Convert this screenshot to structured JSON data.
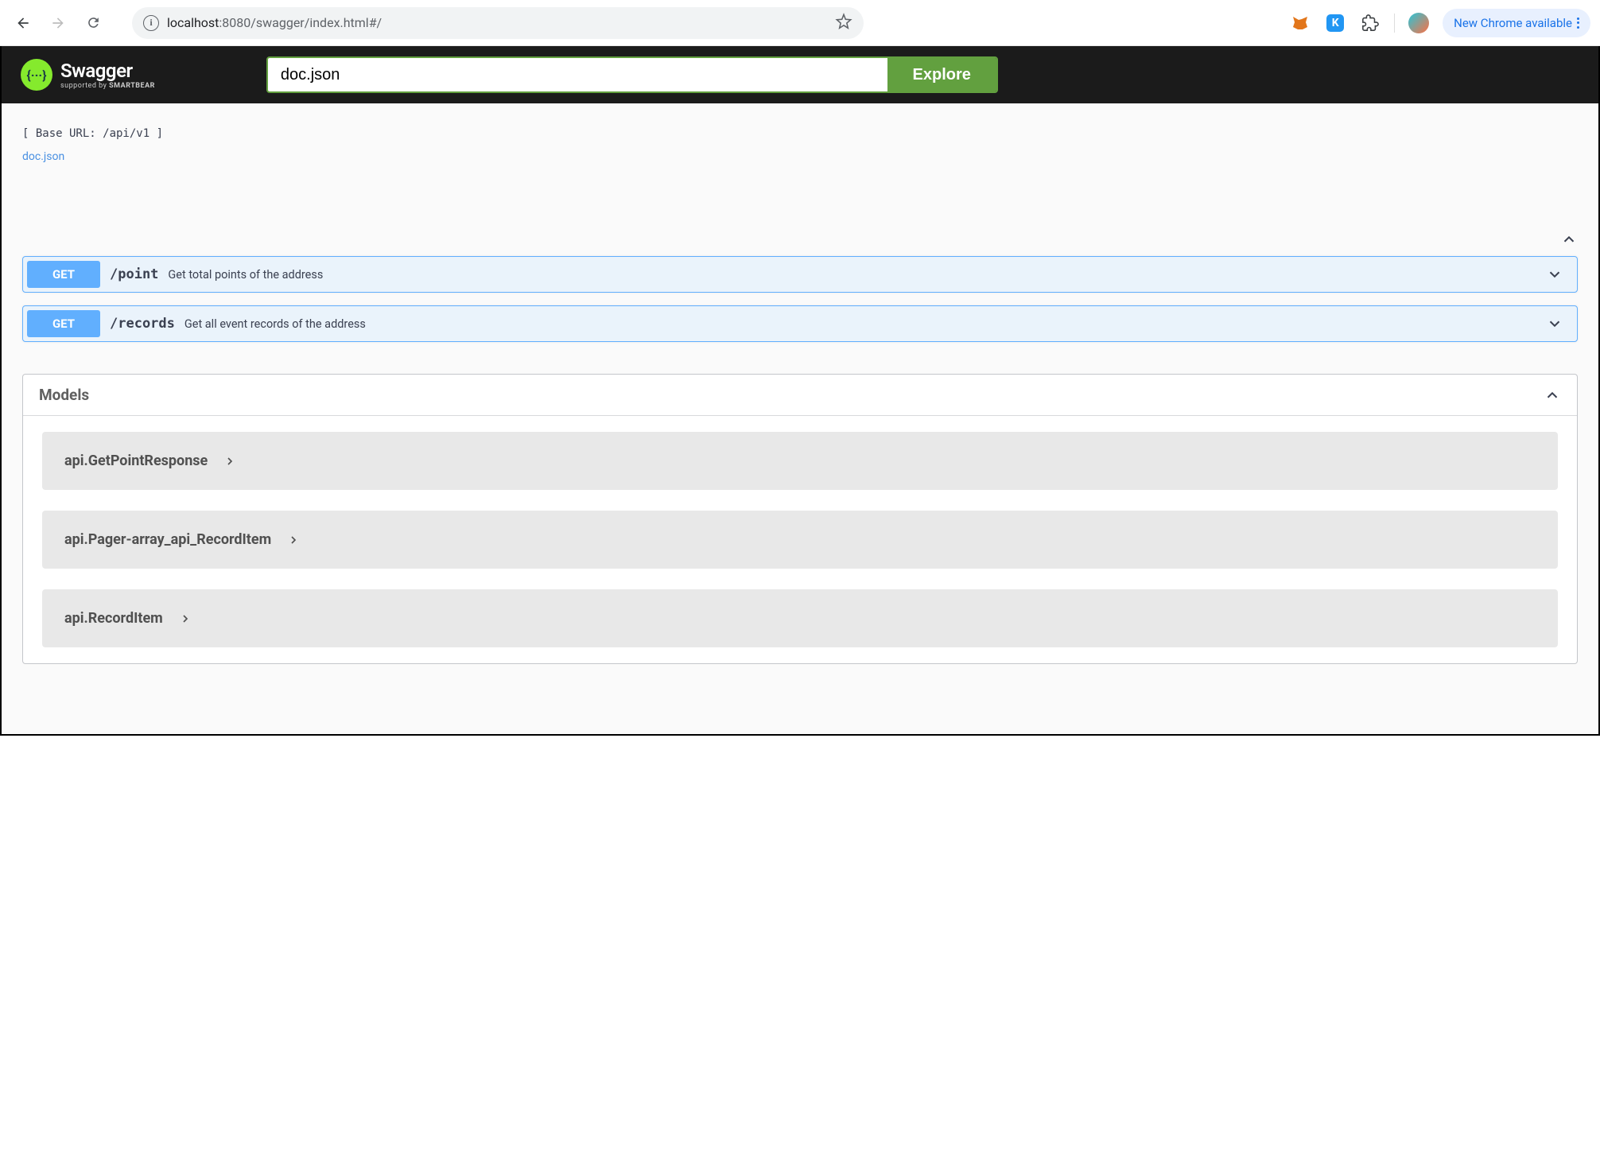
{
  "browser": {
    "url_prefix": "localhost",
    "url_port_path": ":8080/swagger/index.html#/",
    "new_chrome_label": "New Chrome available"
  },
  "topbar": {
    "logo_main": "Swagger",
    "logo_sub_prefix": "supported by ",
    "logo_sub_brand": "SMARTBEAR",
    "input_value": "doc.json",
    "explore_label": "Explore"
  },
  "info": {
    "base_url_line": "[ Base URL: /api/v1 ]",
    "doc_link_label": "doc.json"
  },
  "operations": [
    {
      "method": "GET",
      "path": "/point",
      "description": "Get total points of the address"
    },
    {
      "method": "GET",
      "path": "/records",
      "description": "Get all event records of the address"
    }
  ],
  "models": {
    "title": "Models",
    "items": [
      {
        "name": "api.GetPointResponse"
      },
      {
        "name": "api.Pager-array_api_RecordItem"
      },
      {
        "name": "api.RecordItem"
      }
    ]
  }
}
